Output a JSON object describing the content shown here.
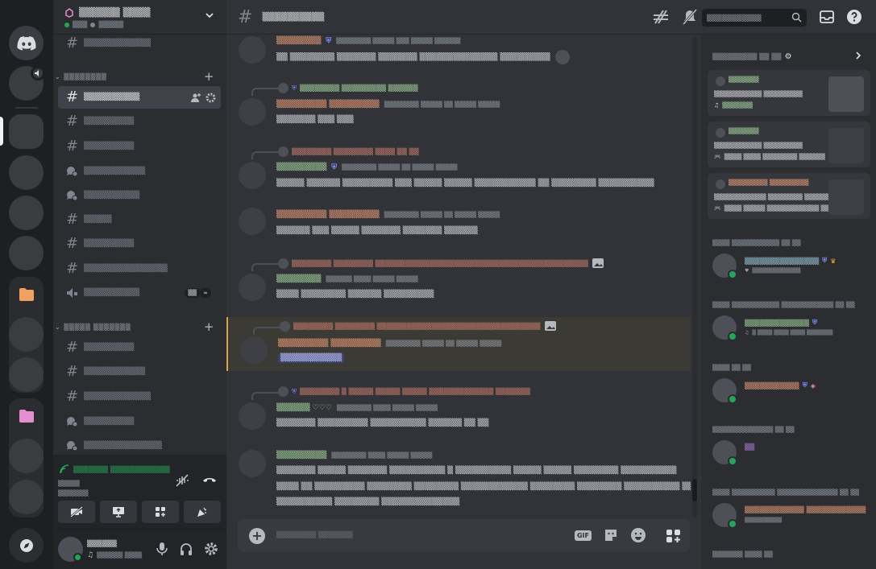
{
  "app": {
    "title": "Discord"
  },
  "colors": {
    "online": "#23a55a",
    "accent_name_orange": "#f0a07a",
    "accent_name_green": "#a8d8a0",
    "mention_bg": "#3c4270",
    "highlight": "#d2a54a"
  },
  "rail": {
    "home_icon": "discord-logo-icon",
    "explore_icon": "compass-icon"
  },
  "guild": {
    "name": "▒▒▒▒▒▒ ▒▒▒▒",
    "sub_a": "▒▒▒",
    "sub_b": "▒▒▒▒▒"
  },
  "categories": [
    {
      "label": "▒▒▒▒▒▒▒▒"
    },
    {
      "label": "▒▒▒▒▒ ▒▒▒▒▒▒▒"
    }
  ],
  "channels": [
    {
      "label": "▒▒▒▒▒▒▒▒▒▒▒▒"
    },
    {
      "label": "▒▒▒▒▒▒▒▒▒▒"
    },
    {
      "label": "▒▒▒▒▒▒▒▒▒"
    },
    {
      "label": "▒▒▒▒▒▒▒▒▒"
    },
    {
      "label": "▒▒▒▒▒▒▒▒▒▒▒"
    },
    {
      "label": "▒▒▒▒▒▒▒▒▒▒"
    },
    {
      "label": "▒▒▒▒▒"
    },
    {
      "label": "▒▒▒▒▒▒▒▒▒"
    },
    {
      "label": "▒▒▒▒▒▒▒▒▒▒▒▒▒▒▒"
    },
    {
      "label": "▒▒▒▒▒▒▒▒▒▒",
      "badge_a": "▒▒",
      "badge_b": "∞"
    },
    {
      "label": "▒▒▒▒▒▒▒▒▒"
    },
    {
      "label": "▒▒▒▒▒▒▒▒▒▒▒"
    },
    {
      "label": "▒▒▒▒▒▒▒▒▒▒▒▒"
    },
    {
      "label": "▒▒▒▒▒▒▒▒▒"
    },
    {
      "label": "▒▒▒▒▒▒▒▒▒▒▒▒▒▒"
    }
  ],
  "voice": {
    "status": "▒▒▒▒▒▒▒ ▒▒▒▒▒▒▒▒▒▒▒▒",
    "channel": "▒▒▒▒▒",
    "server": "▒▒▒▒▒▒▒"
  },
  "user": {
    "name": "▒▒▒▒▒▒",
    "status": "▒▒▒▒▒▒ ▒▒▒▒"
  },
  "chat": {
    "channel_title": "▒▒▒▒▒▒▒▒▒▒",
    "search_placeholder": "▒▒▒▒▒▒▒▒▒▒▒",
    "composer_placeholder": "▒▒▒▒▒▒▒▒ ▒▒▒▒▒▒▒",
    "gif_label": "GIF"
  },
  "messages": [
    {
      "author": "▒▒▒▒▒▒▒▒",
      "ts": "▒▒▒▒▒▒▒▒ ▒▒▒▒▒ ▒▒▒ ▒▒▒▒▒ ▒▒▒▒▒▒",
      "body": "▒▒ ▒▒▒▒▒▒▒▒ ▒▒▒▒▒▒▒ ▒▒▒▒▒▒▒ ▒▒▒▒▒▒▒▒▒▒▒▒▒▒ ▒▒▒▒▒▒▒▒▒"
    },
    {
      "reply": "▒▒▒▒▒▒▒▒ ▒▒▒▒▒▒▒▒▒ ▒▒▒▒▒▒",
      "author": "▒▒▒▒▒▒▒▒▒ ▒▒▒▒▒▒▒▒▒",
      "ts": "▒▒▒▒▒▒▒▒ ▒▒▒▒▒ ▒▒ ▒▒▒▒▒ ▒▒▒▒▒",
      "body": "▒▒▒▒▒▒▒ ▒▒▒ ▒▒▒"
    },
    {
      "reply": "▒▒▒▒▒▒▒▒ ▒▒▒▒▒▒▒▒ ▒▒▒▒ ▒▒ ▒▒",
      "author": "▒▒▒▒▒▒▒▒▒",
      "ts": "▒▒▒▒▒▒▒▒ ▒▒▒▒▒ ▒▒ ▒▒▒▒▒ ▒▒▒▒▒",
      "body": "▒▒▒▒▒ ▒▒▒▒▒▒ ▒▒▒▒▒▒▒▒▒ ▒▒▒ ▒▒▒▒▒ ▒▒▒▒▒ ▒▒▒▒▒▒▒▒▒▒▒ ▒▒ ▒▒▒▒▒▒▒▒ ▒▒▒▒▒▒▒▒▒▒"
    },
    {
      "author": "▒▒▒▒▒▒▒▒▒ ▒▒▒▒▒▒▒▒▒",
      "ts": "▒▒▒▒▒▒▒▒ ▒▒▒▒▒ ▒▒ ▒▒▒▒▒ ▒▒▒▒▒",
      "body": "▒▒▒▒▒▒ ▒▒▒ ▒▒▒▒▒ ▒▒▒▒▒▒▒ ▒▒▒▒▒▒▒ ▒▒▒▒▒▒"
    },
    {
      "reply": "▒▒▒▒▒▒▒▒ ▒▒▒▒▒▒▒▒ ▒▒▒▒▒▒▒▒▒▒▒▒▒▒▒▒▒▒▒▒▒▒▒▒▒▒▒▒▒▒▒▒▒▒▒▒▒▒▒▒▒▒▒",
      "author": "▒▒▒▒▒▒▒▒",
      "ts": "▒▒▒▒▒▒ ▒▒▒▒ ▒▒▒▒▒ ▒▒▒▒▒",
      "body": "▒▒▒▒ ▒▒▒▒▒▒▒▒ ▒▒▒▒▒▒ ▒▒▒▒▒▒▒▒▒"
    },
    {
      "reply": "▒▒▒▒▒▒▒▒ ▒▒▒▒▒▒▒▒ ▒▒▒▒▒▒▒▒▒▒▒▒▒▒▒▒▒▒▒▒▒▒▒▒▒▒▒▒▒▒▒▒▒",
      "author": "▒▒▒▒▒▒▒▒▒ ▒▒▒▒▒▒▒▒▒",
      "ts": "▒▒▒▒▒▒▒▒ ▒▒▒▒▒ ▒▒ ▒▒▒▒▒ ▒▒▒▒▒",
      "body": "▒▒▒▒▒▒▒▒▒▒▒"
    },
    {
      "reply": "▒▒▒▒▒▒▒▒ ▒ ▒▒▒▒▒ ▒▒▒▒▒ ▒▒▒▒▒ ▒▒▒▒▒▒▒▒▒▒▒▒▒ ▒▒▒▒▒▒▒",
      "author": "▒▒▒▒▒▒ ♡♡♡",
      "ts": "▒▒▒▒▒▒▒▒ ▒▒▒▒ ▒▒▒▒▒ ▒▒▒▒▒",
      "body": "▒▒▒▒▒▒▒ ▒▒▒▒▒▒▒▒▒ ▒▒▒▒▒▒▒▒▒▒ ▒▒▒▒▒▒ ▒▒ ▒▒"
    },
    {
      "author": "▒▒▒▒▒▒▒▒▒",
      "ts": "▒▒▒▒▒▒▒▒ ▒▒▒▒ ▒▒▒▒▒ ▒▒▒▒▒",
      "body": "▒▒▒▒▒▒▒ ▒▒▒▒▒ ▒▒▒▒▒▒▒ ▒▒▒▒▒▒▒▒▒▒ ▒ ▒▒▒▒▒▒▒▒▒▒ ▒▒▒▒▒ ▒▒▒▒▒ ▒▒▒▒▒▒▒▒ ▒▒▒▒▒▒▒▒▒▒",
      "body2": "▒▒▒▒ ▒▒ ▒▒▒▒▒▒▒▒▒ ▒▒▒▒▒▒▒▒ ▒▒▒▒▒▒▒▒ ▒▒▒▒▒▒▒▒▒▒▒▒ ▒▒▒▒▒▒▒▒ ▒▒▒▒▒▒▒▒ ▒▒▒▒▒▒▒▒▒▒ ▒▒▒▒▒▒▒▒▒▒▒ ▒▒▒▒▒▒▒▒▒▒▒▒▒▒▒▒ ▒▒▒▒▒▒▒▒▒",
      "body3": "▒▒▒▒▒▒▒▒▒▒ ▒▒▒▒▒▒▒▒ ▒▒▒▒▒▒▒▒▒▒▒▒▒▒"
    }
  ],
  "activity": {
    "header": "▒▒▒▒▒▒▒▒▒ ▒▒ ▒▒",
    "cards": [
      {
        "name": "▒▒▒▒▒▒▒",
        "line1": "▒▒▒▒▒▒▒▒▒▒▒ ▒▒▒▒▒▒▒▒▒",
        "line2": "▒▒▒▒▒▒▒"
      },
      {
        "name": "▒▒▒▒▒▒▒",
        "line1": "▒▒▒▒▒▒▒▒▒▒▒ ▒▒▒▒▒▒▒▒▒",
        "line2": "▒▒▒▒ ▒▒▒▒ ▒▒▒▒▒▒▒▒ ▒▒▒▒▒▒"
      },
      {
        "name": "▒▒▒▒▒▒▒▒▒ ▒▒▒▒▒▒▒▒▒",
        "line1": "▒▒▒▒▒▒▒▒▒▒▒▒ ▒▒▒▒▒▒▒▒ ▒▒▒▒▒▒▒▒▒▒▒",
        "line2": "▒▒▒▒ ▒▒▒▒▒ ▒▒▒▒▒▒▒▒▒▒▒▒ ▒▒"
      }
    ],
    "groups": [
      {
        "label": "▒▒▒▒ ▒▒▒▒▒▒▒▒▒▒▒ ▒▒ ▒▒",
        "member": {
          "name": "▒▒▒▒▒▒▒▒▒▒▒▒▒▒▒",
          "activity": "▒▒▒▒▒▒▒▒▒▒▒▒▒"
        }
      },
      {
        "label": "▒▒▒▒ ▒▒▒▒▒▒▒▒▒▒▒ ▒▒▒▒▒▒▒▒▒▒▒▒ ▒▒ ▒▒",
        "member": {
          "name": "▒▒▒▒▒▒▒▒▒▒▒▒▒",
          "activity": "▒ ▒▒▒▒ ▒▒▒▒ ▒▒▒▒ ▒▒▒▒▒▒▒"
        }
      },
      {
        "label": "▒▒▒▒ ▒▒ ▒▒",
        "member": {
          "name": "▒▒▒▒▒▒▒▒▒▒▒",
          "activity": ""
        }
      },
      {
        "label": "▒▒▒▒▒▒▒▒▒▒▒▒▒▒ ▒▒ ▒▒",
        "member": {
          "name": "▒▒",
          "activity": ""
        }
      },
      {
        "label": "▒▒▒▒ ▒▒▒▒▒▒▒▒▒▒ ▒▒▒▒▒▒▒▒▒▒▒▒▒▒ ▒▒ ▒▒",
        "member": {
          "name": "▒▒▒▒▒▒▒▒▒▒▒▒ ▒▒▒▒▒▒▒▒▒▒▒▒",
          "activity": "▒▒▒▒▒▒▒▒▒▒"
        }
      },
      {
        "label": "▒▒▒▒▒▒▒ ▒▒▒▒ ▒▒"
      }
    ]
  }
}
